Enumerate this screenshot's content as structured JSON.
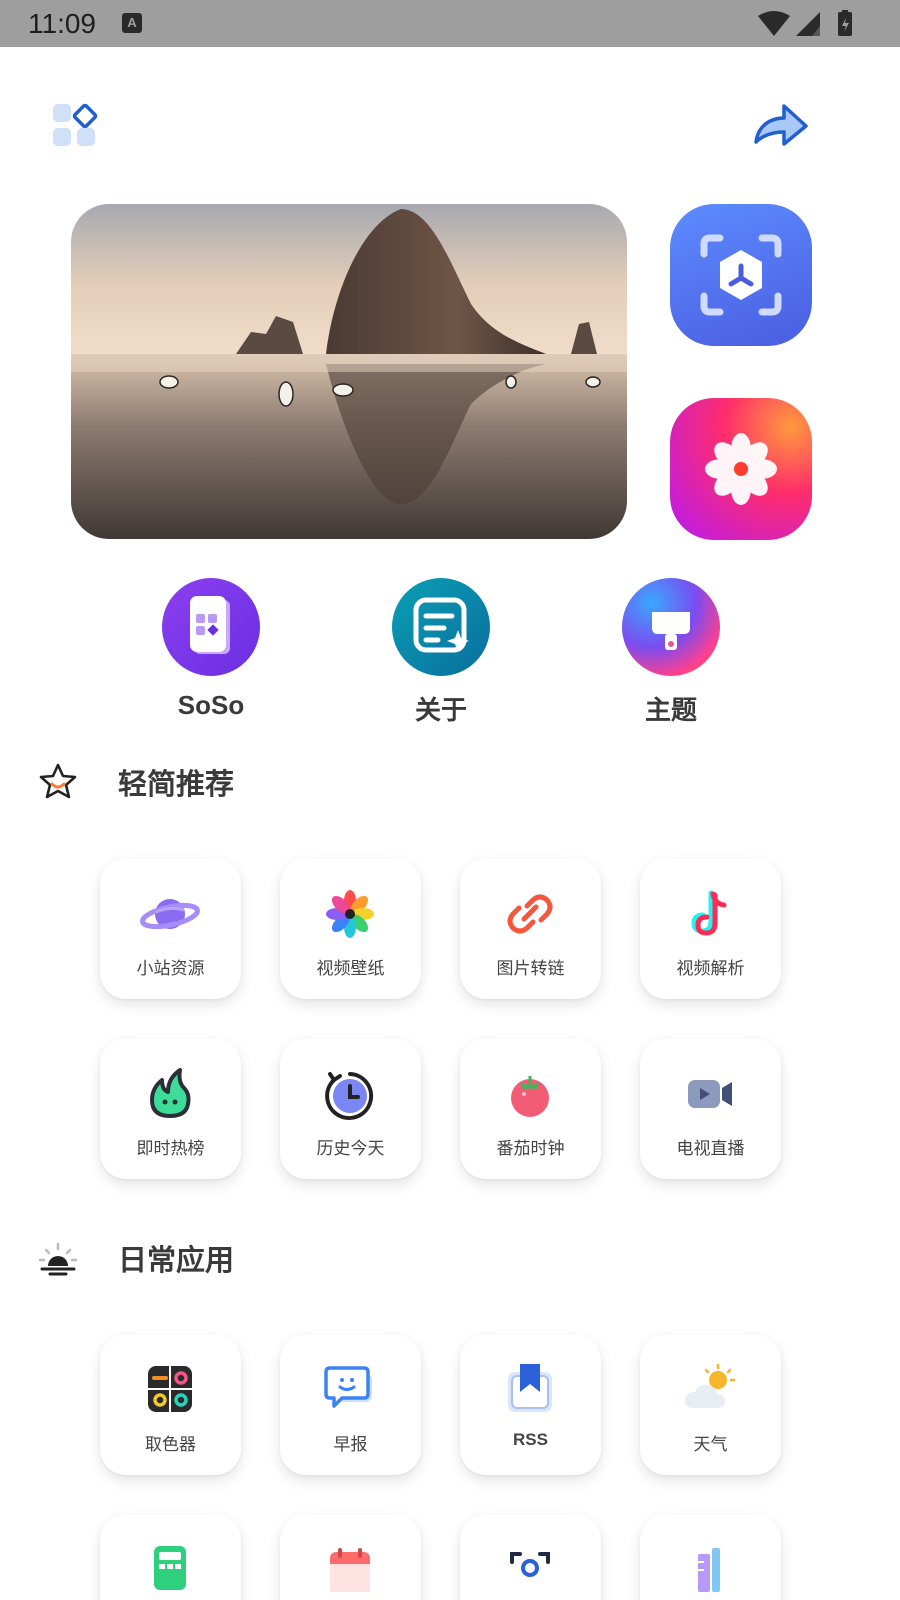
{
  "status_bar": {
    "time": "11:09",
    "notification_icon": "a-notification-icon"
  },
  "top_bar": {
    "left_icon": "apps-grid-icon",
    "right_icon": "share-arrow-icon"
  },
  "hero": {
    "image": "sea-stack-beach-photo"
  },
  "side_apps": [
    {
      "name": "scan-app",
      "icon": "scan-frame-icon"
    },
    {
      "name": "flower-app",
      "icon": "flower-icon"
    }
  ],
  "quick_links": [
    {
      "label": "SoSo",
      "icon": "phone-grid-icon"
    },
    {
      "label": "关于",
      "icon": "note-sparkle-icon"
    },
    {
      "label": "主题",
      "icon": "paint-brush-icon"
    }
  ],
  "sections": [
    {
      "title": "轻简推荐",
      "icon": "star-icon",
      "items": [
        {
          "label": "小站资源",
          "icon": "planet-icon"
        },
        {
          "label": "视频壁纸",
          "icon": "pinwheel-icon"
        },
        {
          "label": "图片转链",
          "icon": "link-icon"
        },
        {
          "label": "视频解析",
          "icon": "tiktok-icon"
        },
        {
          "label": "即时热榜",
          "icon": "flame-icon"
        },
        {
          "label": "历史今天",
          "icon": "clock-history-icon"
        },
        {
          "label": "番茄时钟",
          "icon": "tomato-icon"
        },
        {
          "label": "电视直播",
          "icon": "video-camera-icon"
        }
      ]
    },
    {
      "title": "日常应用",
      "icon": "sunrise-icon",
      "items": [
        {
          "label": "取色器",
          "icon": "color-picker-icon"
        },
        {
          "label": "早报",
          "icon": "chat-bubble-icon"
        },
        {
          "label": "RSS",
          "icon": "bookmark-icon"
        },
        {
          "label": "天气",
          "icon": "weather-icon"
        },
        {
          "label": "",
          "icon": "calculator-icon"
        },
        {
          "label": "",
          "icon": "calendar-icon"
        },
        {
          "label": "",
          "icon": "scanner-icon"
        },
        {
          "label": "",
          "icon": "ruler-pencil-icon"
        }
      ]
    }
  ]
}
